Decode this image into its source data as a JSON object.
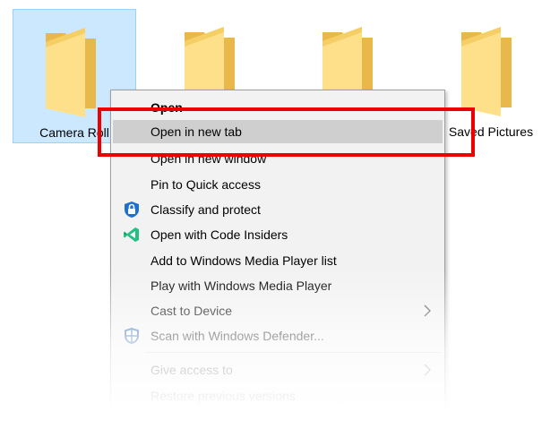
{
  "folders": [
    {
      "name": "Camera Roll",
      "selected": true
    },
    {
      "name": "",
      "selected": false
    },
    {
      "name": "",
      "selected": false
    },
    {
      "name": "Saved Pictures",
      "selected": false
    }
  ],
  "context_menu": {
    "items": [
      {
        "label": "Open",
        "bold": true
      },
      {
        "label": "Open in new tab",
        "highlighted": true
      },
      {
        "label": "Open in new window"
      },
      {
        "label": "Pin to Quick access"
      },
      {
        "label": "Classify and protect",
        "icon": "lock-shield-icon"
      },
      {
        "label": "Open with Code Insiders",
        "icon": "vscode-insiders-icon"
      },
      {
        "label": "Add to Windows Media Player list"
      },
      {
        "label": "Play with Windows Media Player"
      },
      {
        "label": "Cast to Device",
        "submenu": true
      },
      {
        "label": "Scan with Windows Defender...",
        "icon": "defender-shield-icon"
      },
      {
        "label": "Give access to",
        "submenu": true
      },
      {
        "label": "Restore previous versions"
      }
    ]
  },
  "colors": {
    "selection_fill": "#cce8ff",
    "selection_border": "#99d1ff",
    "menu_background": "#f2f2f2",
    "menu_highlight": "#cfcfcf",
    "annotation_red": "#ee0000",
    "folder_yellow": "#f7d675"
  }
}
